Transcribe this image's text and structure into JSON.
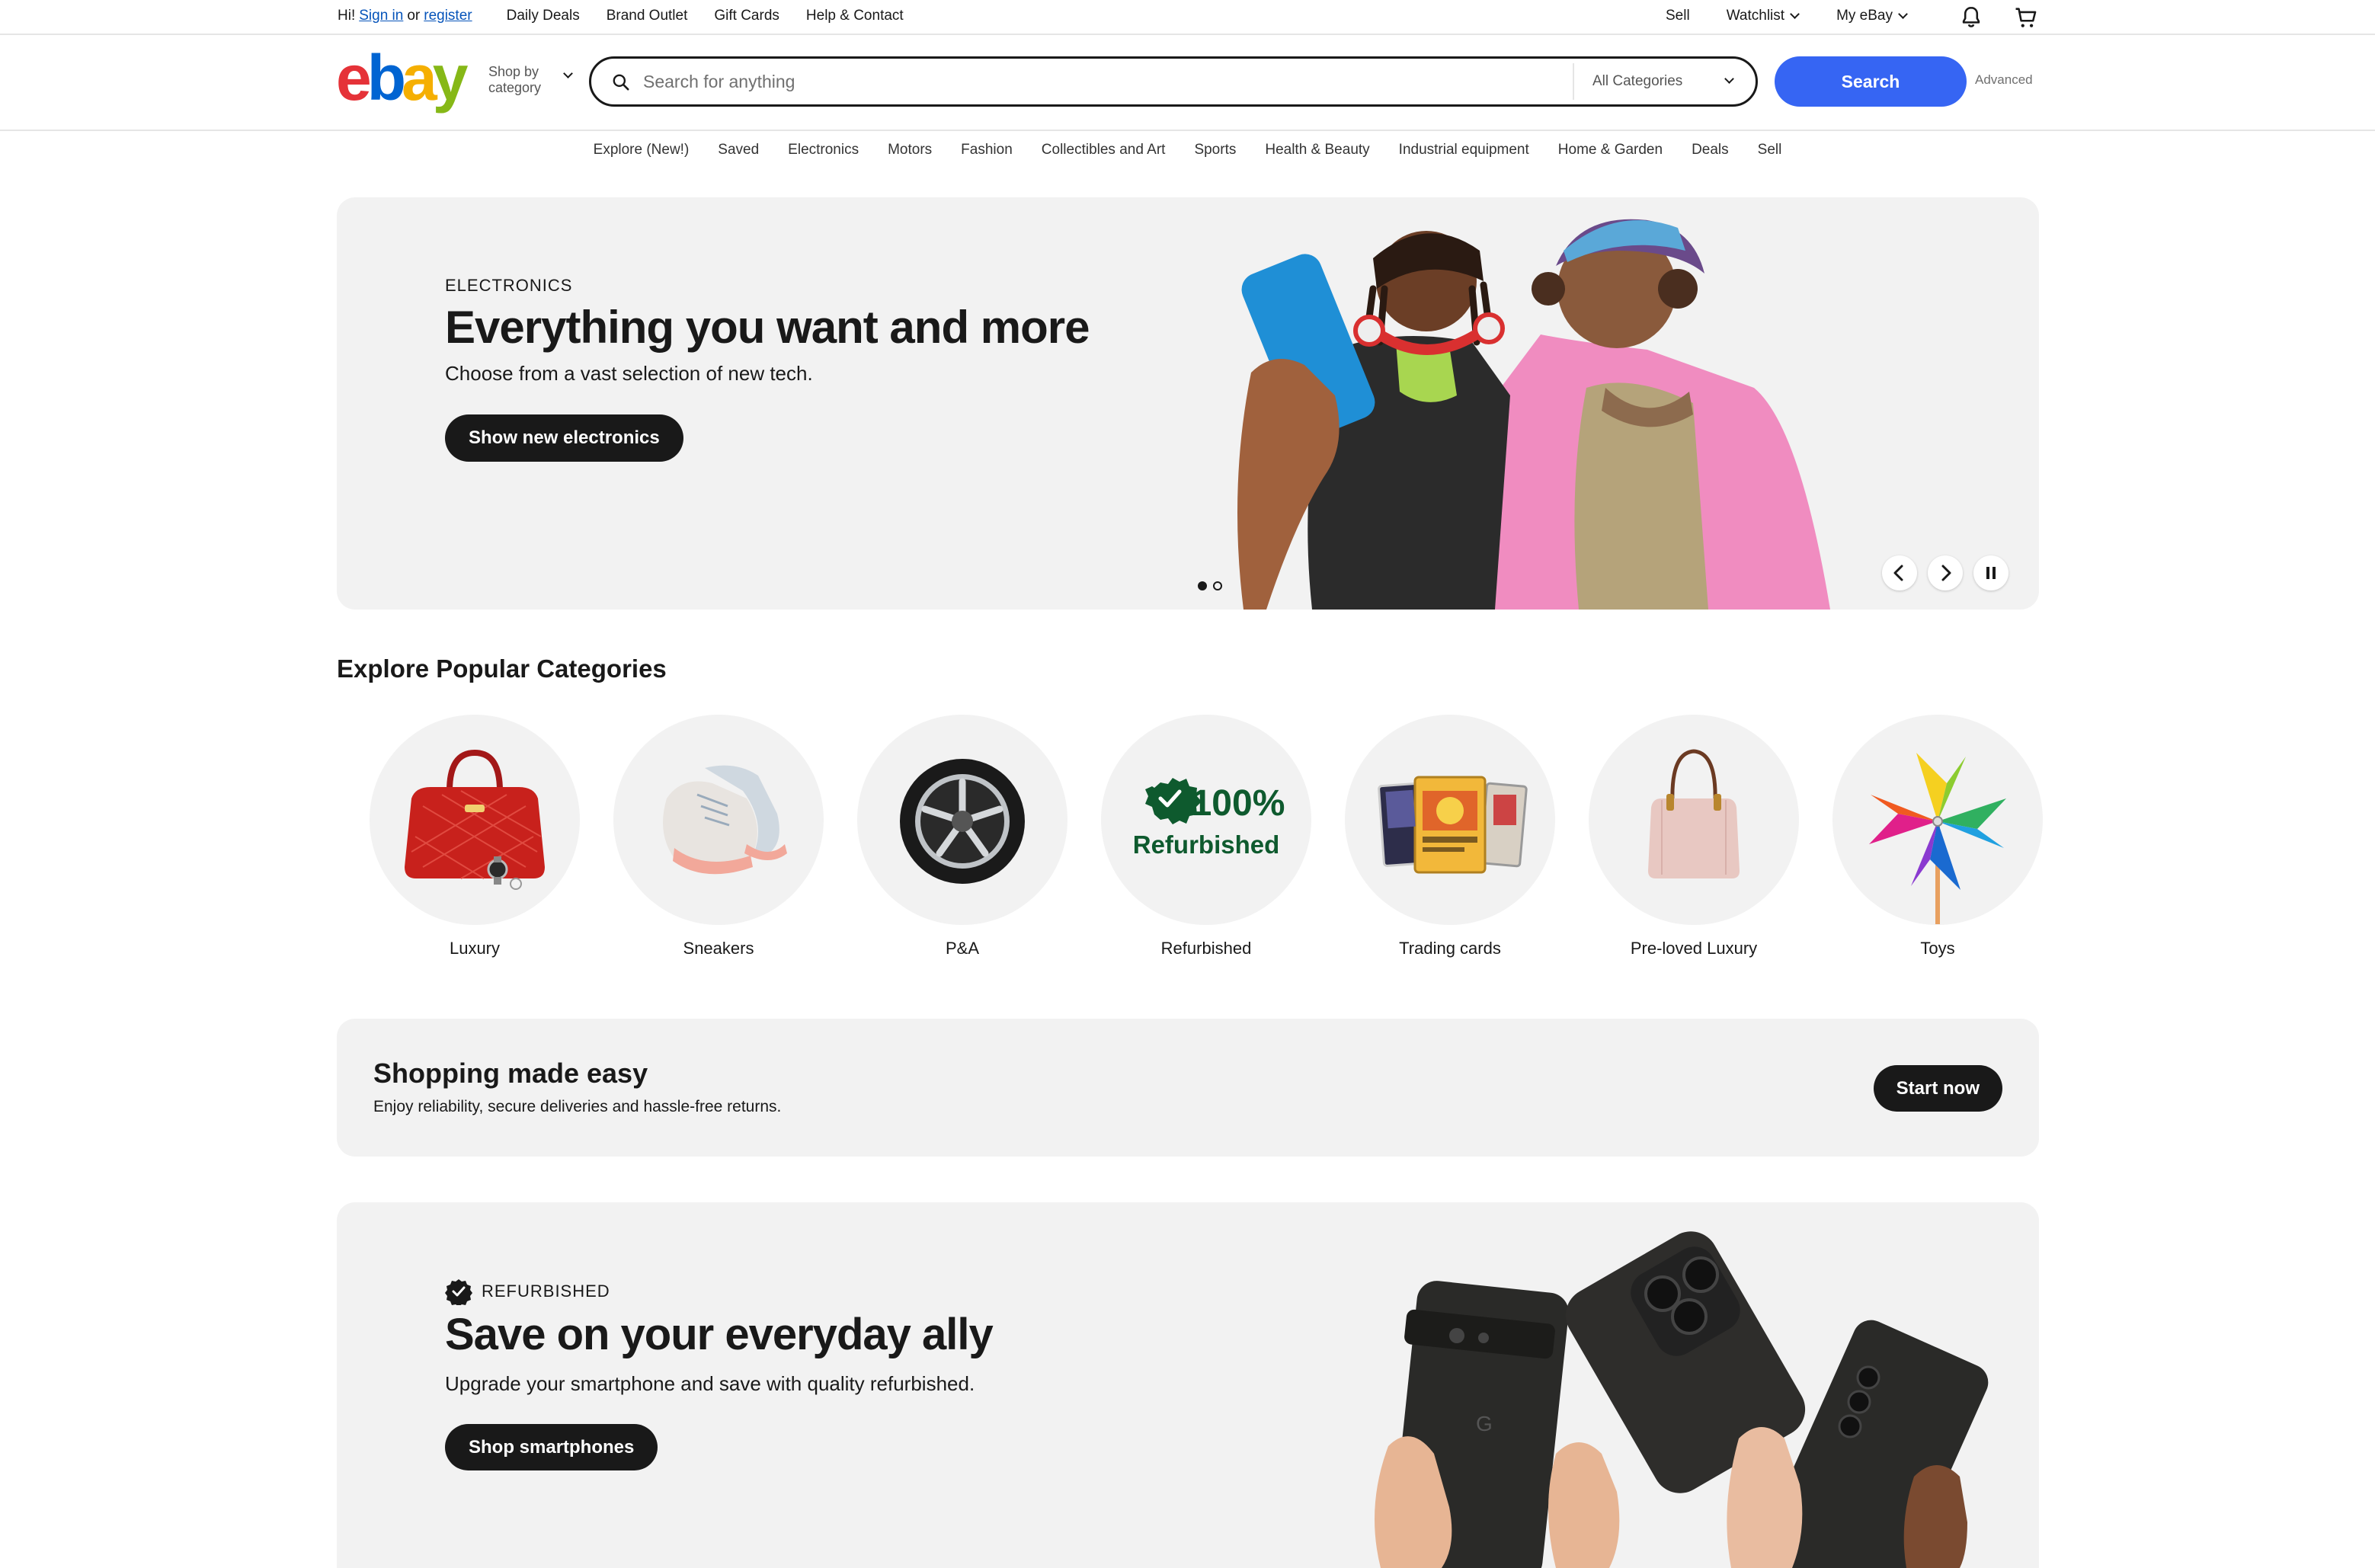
{
  "topbar": {
    "greeting": "Hi!",
    "sign_in": "Sign in",
    "or": "or",
    "register": "register",
    "links": [
      "Daily Deals",
      "Brand Outlet",
      "Gift Cards",
      "Help & Contact"
    ],
    "sell": "Sell",
    "watchlist": "Watchlist",
    "my_ebay": "My eBay"
  },
  "header": {
    "logo_letters": [
      "e",
      "b",
      "a",
      "y"
    ],
    "shop_by_line1": "Shop by",
    "shop_by_line2": "category",
    "search_placeholder": "Search for anything",
    "category_select": "All Categories",
    "search_button": "Search",
    "advanced": "Advanced"
  },
  "catnav": [
    "Explore (New!)",
    "Saved",
    "Electronics",
    "Motors",
    "Fashion",
    "Collectibles and Art",
    "Sports",
    "Health & Beauty",
    "Industrial equipment",
    "Home & Garden",
    "Deals",
    "Sell"
  ],
  "hero": {
    "kicker": "ELECTRONICS",
    "title": "Everything you want and more",
    "subtitle": "Choose from a vast selection of new tech.",
    "cta": "Show new electronics",
    "active_slide": 1,
    "slide_count": 2
  },
  "popular": {
    "title": "Explore Popular Categories",
    "items": [
      {
        "label": "Luxury",
        "icon": "handbag-icon"
      },
      {
        "label": "Sneakers",
        "icon": "sneaker-icon"
      },
      {
        "label": "P&A",
        "icon": "wheel-icon"
      },
      {
        "label": "Refurbished",
        "icon": "refurbished-badge-icon",
        "badge_line1": "100%",
        "badge_line2": "Refurbished"
      },
      {
        "label": "Trading cards",
        "icon": "trading-cards-icon"
      },
      {
        "label": "Pre-loved Luxury",
        "icon": "tote-bag-icon"
      },
      {
        "label": "Toys",
        "icon": "pinwheel-icon"
      }
    ]
  },
  "easy": {
    "title": "Shopping made easy",
    "subtitle": "Enjoy reliability, secure deliveries and hassle-free returns.",
    "cta": "Start now"
  },
  "promo": {
    "kicker": "REFURBISHED",
    "title": "Save on your everyday ally",
    "subtitle": "Upgrade your smartphone and save with quality refurbished.",
    "cta": "Shop smartphones"
  },
  "colors": {
    "primary_blue": "#3665f3",
    "link_blue": "#0654ba",
    "logo_red": "#e53238",
    "logo_blue": "#0064d2",
    "logo_yellow": "#f5af02",
    "logo_green": "#86b817",
    "refurb_green": "#0e5a2e",
    "panel_gray": "#f2f2f2"
  }
}
